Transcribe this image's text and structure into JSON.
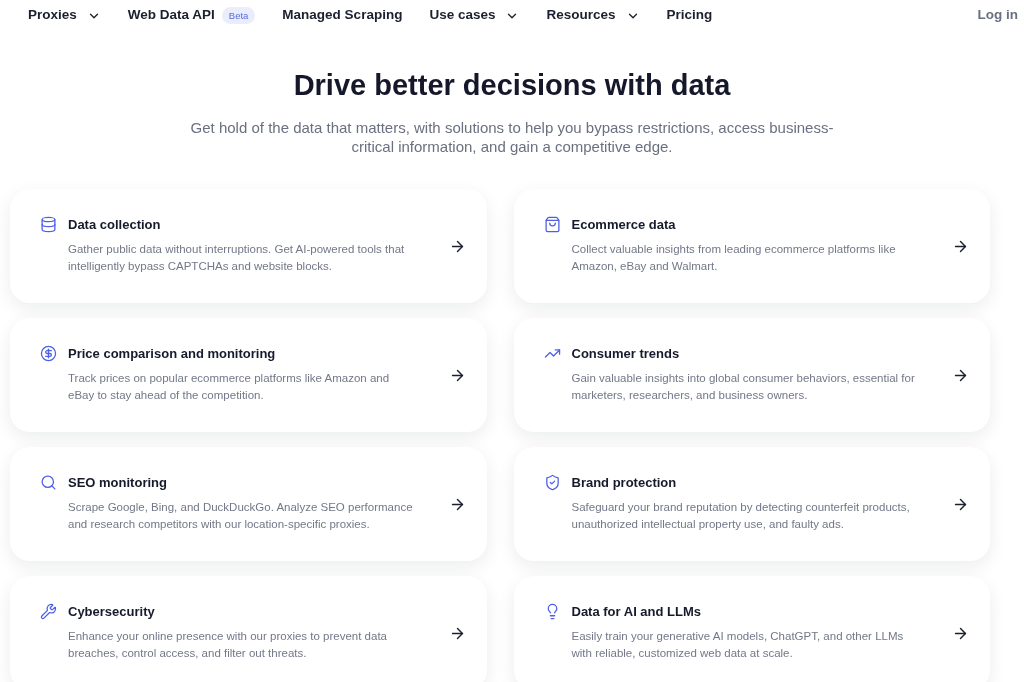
{
  "nav": {
    "items": [
      {
        "label": "Proxies",
        "kind": "dropdown"
      },
      {
        "label": "Web Data API",
        "kind": "badge",
        "badge": "Beta"
      },
      {
        "label": "Managed Scraping",
        "kind": "link"
      },
      {
        "label": "Use cases",
        "kind": "dropdown"
      },
      {
        "label": "Resources",
        "kind": "dropdown"
      },
      {
        "label": "Pricing",
        "kind": "link"
      }
    ],
    "login": "Log in"
  },
  "hero": {
    "title": "Drive better decisions with data",
    "subtitle": "Get hold of the data that matters, with solutions to help you bypass restrictions, access business-critical information, and gain a competitive edge."
  },
  "cards": [
    {
      "title": "Data collection",
      "description": "Gather public data without interruptions. Get AI-powered tools that intelligently bypass CAPTCHAs and website blocks."
    },
    {
      "title": "Ecommerce data",
      "description": "Collect valuable insights from leading ecommerce platforms like Amazon, eBay and Walmart."
    },
    {
      "title": "Price comparison and monitoring",
      "description": "Track prices on popular ecommerce platforms like Amazon and eBay to stay ahead of the competition."
    },
    {
      "title": "Consumer trends",
      "description": "Gain valuable insights into global consumer behaviors, essential for marketers, researchers, and business owners."
    },
    {
      "title": "SEO monitoring",
      "description": "Scrape Google, Bing, and DuckDuckGo. Analyze SEO performance and research competitors with our location-specific proxies."
    },
    {
      "title": "Brand protection",
      "description": "Safeguard your brand reputation by detecting counterfeit products, unauthorized intellectual property use, and faulty ads."
    },
    {
      "title": "Cybersecurity",
      "description": "Enhance your online presence with our proxies to prevent data breaches, control access, and filter out threats."
    },
    {
      "title": "Data for AI and LLMs",
      "description": "Easily train your generative AI models, ChatGPT, and other LLMs with reliable, customized web data at scale."
    }
  ]
}
